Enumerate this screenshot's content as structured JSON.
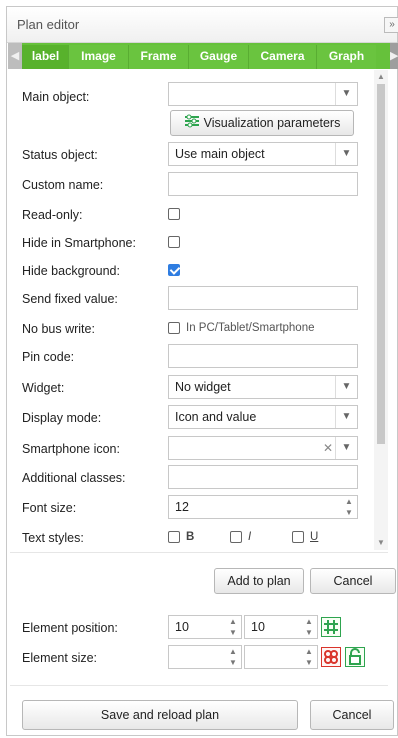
{
  "title": "Plan editor",
  "collapse_label": "»",
  "tabs": [
    {
      "label": "label"
    },
    {
      "label": "Image"
    },
    {
      "label": "Frame"
    },
    {
      "label": "Gauge"
    },
    {
      "label": "Camera"
    },
    {
      "label": "Graph"
    }
  ],
  "fields": {
    "main_object": {
      "label": "Main object:",
      "value": ""
    },
    "visualization_button": "Visualization parameters",
    "status_object": {
      "label": "Status object:",
      "value": "Use main object"
    },
    "custom_name": {
      "label": "Custom name:",
      "value": ""
    },
    "read_only": {
      "label": "Read-only:",
      "checked": false
    },
    "hide_smartphone": {
      "label": "Hide in Smartphone:",
      "checked": false
    },
    "hide_background": {
      "label": "Hide background:",
      "checked": true
    },
    "send_fixed_value": {
      "label": "Send fixed value:",
      "value": ""
    },
    "no_bus_write": {
      "label": "No bus write:",
      "checked": false,
      "note": "In PC/Tablet/Smartphone"
    },
    "pin_code": {
      "label": "Pin code:",
      "value": ""
    },
    "widget": {
      "label": "Widget:",
      "value": "No widget"
    },
    "display_mode": {
      "label": "Display mode:",
      "value": "Icon and value"
    },
    "smartphone_icon": {
      "label": "Smartphone icon:",
      "value": ""
    },
    "additional_classes": {
      "label": "Additional classes:",
      "value": ""
    },
    "font_size": {
      "label": "Font size:",
      "value": "12"
    },
    "text_styles": {
      "label": "Text styles:",
      "bold": "B",
      "italic": "I",
      "underline": "U"
    }
  },
  "actions": {
    "add_to_plan": "Add to plan",
    "cancel": "Cancel"
  },
  "element": {
    "position_label": "Element position:",
    "position_x": "10",
    "position_y": "10",
    "size_label": "Element size:",
    "size_w": "",
    "size_h": ""
  },
  "footer": {
    "save_reload": "Save and reload plan",
    "cancel": "Cancel"
  },
  "colors": {
    "tab_green": "#66c13b",
    "accent_blue": "#2f7de1",
    "grid_icon_green": "#2ea44f",
    "red_icon": "#d9342b"
  }
}
